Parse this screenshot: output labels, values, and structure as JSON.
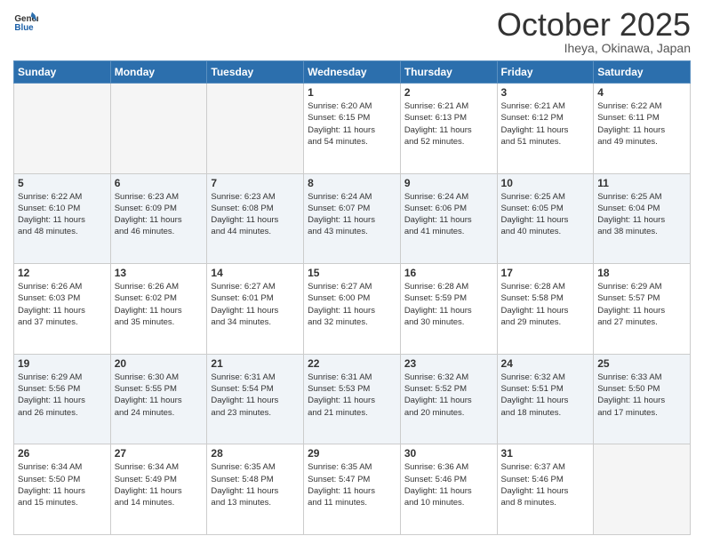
{
  "header": {
    "logo_general": "General",
    "logo_blue": "Blue",
    "month": "October 2025",
    "location": "Iheya, Okinawa, Japan"
  },
  "days_of_week": [
    "Sunday",
    "Monday",
    "Tuesday",
    "Wednesday",
    "Thursday",
    "Friday",
    "Saturday"
  ],
  "weeks": [
    [
      {
        "day": "",
        "info": ""
      },
      {
        "day": "",
        "info": ""
      },
      {
        "day": "",
        "info": ""
      },
      {
        "day": "1",
        "info": "Sunrise: 6:20 AM\nSunset: 6:15 PM\nDaylight: 11 hours\nand 54 minutes."
      },
      {
        "day": "2",
        "info": "Sunrise: 6:21 AM\nSunset: 6:13 PM\nDaylight: 11 hours\nand 52 minutes."
      },
      {
        "day": "3",
        "info": "Sunrise: 6:21 AM\nSunset: 6:12 PM\nDaylight: 11 hours\nand 51 minutes."
      },
      {
        "day": "4",
        "info": "Sunrise: 6:22 AM\nSunset: 6:11 PM\nDaylight: 11 hours\nand 49 minutes."
      }
    ],
    [
      {
        "day": "5",
        "info": "Sunrise: 6:22 AM\nSunset: 6:10 PM\nDaylight: 11 hours\nand 48 minutes."
      },
      {
        "day": "6",
        "info": "Sunrise: 6:23 AM\nSunset: 6:09 PM\nDaylight: 11 hours\nand 46 minutes."
      },
      {
        "day": "7",
        "info": "Sunrise: 6:23 AM\nSunset: 6:08 PM\nDaylight: 11 hours\nand 44 minutes."
      },
      {
        "day": "8",
        "info": "Sunrise: 6:24 AM\nSunset: 6:07 PM\nDaylight: 11 hours\nand 43 minutes."
      },
      {
        "day": "9",
        "info": "Sunrise: 6:24 AM\nSunset: 6:06 PM\nDaylight: 11 hours\nand 41 minutes."
      },
      {
        "day": "10",
        "info": "Sunrise: 6:25 AM\nSunset: 6:05 PM\nDaylight: 11 hours\nand 40 minutes."
      },
      {
        "day": "11",
        "info": "Sunrise: 6:25 AM\nSunset: 6:04 PM\nDaylight: 11 hours\nand 38 minutes."
      }
    ],
    [
      {
        "day": "12",
        "info": "Sunrise: 6:26 AM\nSunset: 6:03 PM\nDaylight: 11 hours\nand 37 minutes."
      },
      {
        "day": "13",
        "info": "Sunrise: 6:26 AM\nSunset: 6:02 PM\nDaylight: 11 hours\nand 35 minutes."
      },
      {
        "day": "14",
        "info": "Sunrise: 6:27 AM\nSunset: 6:01 PM\nDaylight: 11 hours\nand 34 minutes."
      },
      {
        "day": "15",
        "info": "Sunrise: 6:27 AM\nSunset: 6:00 PM\nDaylight: 11 hours\nand 32 minutes."
      },
      {
        "day": "16",
        "info": "Sunrise: 6:28 AM\nSunset: 5:59 PM\nDaylight: 11 hours\nand 30 minutes."
      },
      {
        "day": "17",
        "info": "Sunrise: 6:28 AM\nSunset: 5:58 PM\nDaylight: 11 hours\nand 29 minutes."
      },
      {
        "day": "18",
        "info": "Sunrise: 6:29 AM\nSunset: 5:57 PM\nDaylight: 11 hours\nand 27 minutes."
      }
    ],
    [
      {
        "day": "19",
        "info": "Sunrise: 6:29 AM\nSunset: 5:56 PM\nDaylight: 11 hours\nand 26 minutes."
      },
      {
        "day": "20",
        "info": "Sunrise: 6:30 AM\nSunset: 5:55 PM\nDaylight: 11 hours\nand 24 minutes."
      },
      {
        "day": "21",
        "info": "Sunrise: 6:31 AM\nSunset: 5:54 PM\nDaylight: 11 hours\nand 23 minutes."
      },
      {
        "day": "22",
        "info": "Sunrise: 6:31 AM\nSunset: 5:53 PM\nDaylight: 11 hours\nand 21 minutes."
      },
      {
        "day": "23",
        "info": "Sunrise: 6:32 AM\nSunset: 5:52 PM\nDaylight: 11 hours\nand 20 minutes."
      },
      {
        "day": "24",
        "info": "Sunrise: 6:32 AM\nSunset: 5:51 PM\nDaylight: 11 hours\nand 18 minutes."
      },
      {
        "day": "25",
        "info": "Sunrise: 6:33 AM\nSunset: 5:50 PM\nDaylight: 11 hours\nand 17 minutes."
      }
    ],
    [
      {
        "day": "26",
        "info": "Sunrise: 6:34 AM\nSunset: 5:50 PM\nDaylight: 11 hours\nand 15 minutes."
      },
      {
        "day": "27",
        "info": "Sunrise: 6:34 AM\nSunset: 5:49 PM\nDaylight: 11 hours\nand 14 minutes."
      },
      {
        "day": "28",
        "info": "Sunrise: 6:35 AM\nSunset: 5:48 PM\nDaylight: 11 hours\nand 13 minutes."
      },
      {
        "day": "29",
        "info": "Sunrise: 6:35 AM\nSunset: 5:47 PM\nDaylight: 11 hours\nand 11 minutes."
      },
      {
        "day": "30",
        "info": "Sunrise: 6:36 AM\nSunset: 5:46 PM\nDaylight: 11 hours\nand 10 minutes."
      },
      {
        "day": "31",
        "info": "Sunrise: 6:37 AM\nSunset: 5:46 PM\nDaylight: 11 hours\nand 8 minutes."
      },
      {
        "day": "",
        "info": ""
      }
    ]
  ]
}
